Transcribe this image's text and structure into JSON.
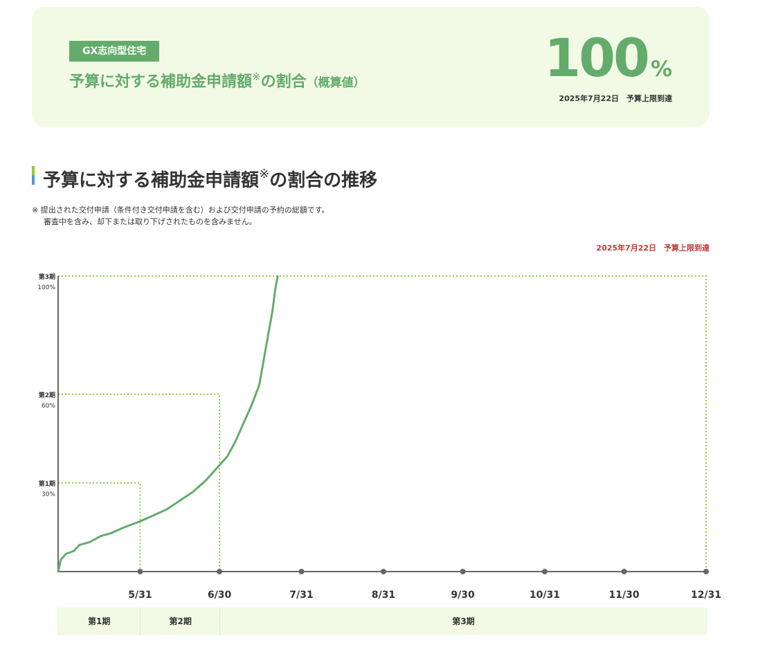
{
  "summary": {
    "badge": "GX志向型住宅",
    "title_main": "予算に対する補助金申請額",
    "title_note_mark": "※",
    "title_suffix": "の割合",
    "title_paren": "（概算値）",
    "percent_value": "100",
    "percent_unit": "%",
    "reached_date": "2025年7月22日",
    "reached_text": "予算上限到達"
  },
  "section": {
    "title_main": "予算に対する補助金申請額",
    "title_note_mark": "※",
    "title_suffix": "の割合の推移"
  },
  "notes": [
    "※ 提出された交付申請（条件付き交付申請を含む）および交付申請の予約の総額です。",
    "審査中を含み、却下または取り下げされたものを含みません。"
  ],
  "chart_reached": {
    "date": "2025年7月22日",
    "text": "予算上限到達"
  },
  "colors": {
    "accent_green": "#63ac6b",
    "light_green_bg": "#f2fae6",
    "dotted_line": "#8ecb2f",
    "axis": "#666666",
    "reached_red": "#c23a3a"
  },
  "chart_data": {
    "type": "line",
    "x_type": "date",
    "xlim": [
      "2025-04-30",
      "2025-12-31"
    ],
    "ylim": [
      0,
      100
    ],
    "ylabel": "",
    "xlabel": "",
    "x_ticks": [
      "2025-05-31",
      "2025-06-30",
      "2025-07-31",
      "2025-08-31",
      "2025-09-30",
      "2025-10-31",
      "2025-11-30",
      "2025-12-31"
    ],
    "x_tick_labels": [
      "5/31",
      "6/30",
      "7/31",
      "8/31",
      "9/30",
      "10/31",
      "11/30",
      "12/31"
    ],
    "thresholds": [
      {
        "period": "第1期",
        "label": "30%",
        "value": 30,
        "end_date": "2025-05-31"
      },
      {
        "period": "第2期",
        "label": "60%",
        "value": 60,
        "end_date": "2025-06-30"
      },
      {
        "period": "第3期",
        "label": "100%",
        "value": 100,
        "end_date": "2025-12-31"
      }
    ],
    "series": [
      {
        "color": "#63ac6b",
        "points": [
          [
            "2025-04-30",
            0
          ],
          [
            "2025-05-01",
            4
          ],
          [
            "2025-05-03",
            6
          ],
          [
            "2025-05-06",
            7
          ],
          [
            "2025-05-08",
            9
          ],
          [
            "2025-05-12",
            10
          ],
          [
            "2025-05-16",
            12
          ],
          [
            "2025-05-20",
            13
          ],
          [
            "2025-05-25",
            15
          ],
          [
            "2025-05-31",
            17
          ],
          [
            "2025-06-05",
            19
          ],
          [
            "2025-06-10",
            21
          ],
          [
            "2025-06-15",
            24
          ],
          [
            "2025-06-20",
            27
          ],
          [
            "2025-06-25",
            31
          ],
          [
            "2025-06-30",
            36
          ],
          [
            "2025-07-03",
            39
          ],
          [
            "2025-07-06",
            44
          ],
          [
            "2025-07-09",
            50
          ],
          [
            "2025-07-12",
            56
          ],
          [
            "2025-07-15",
            63
          ],
          [
            "2025-07-18",
            78
          ],
          [
            "2025-07-20",
            88
          ],
          [
            "2025-07-21",
            95
          ],
          [
            "2025-07-22",
            100
          ]
        ]
      }
    ],
    "periods": [
      {
        "name": "第1期",
        "start": "2025-04-30",
        "end": "2025-05-31"
      },
      {
        "name": "第2期",
        "start": "2025-05-31",
        "end": "2025-06-30"
      },
      {
        "name": "第3期",
        "start": "2025-06-30",
        "end": "2025-12-31"
      }
    ]
  }
}
